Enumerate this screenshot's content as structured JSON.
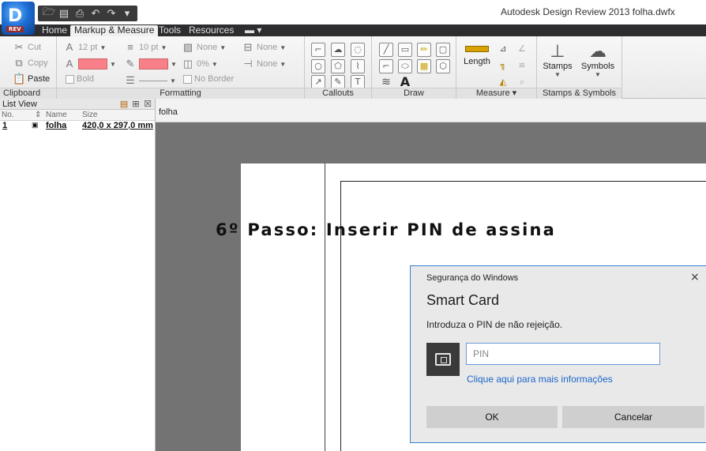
{
  "app": {
    "window_title": "Autodesk Design Review 2013   folha.dwfx",
    "logo_letter": "D",
    "logo_badge": "REV"
  },
  "tabs": [
    {
      "label": "Home"
    },
    {
      "label": "Markup & Measure"
    },
    {
      "label": "Tools"
    },
    {
      "label": "Resources"
    },
    {
      "label": "▬ ▾"
    }
  ],
  "ribbon": {
    "clipboard": {
      "cut": "Cut",
      "copy": "Copy",
      "paste": "Paste",
      "label": "Clipboard"
    },
    "formatting": {
      "font_size": "12 pt",
      "line_weight": "10 pt",
      "fill_none": "None",
      "line_end_none": "None",
      "line_start_none": "None",
      "transparency": "0%",
      "bold": "Bold",
      "no_border": "No Border",
      "label": "Formatting"
    },
    "callouts": {
      "label": "Callouts"
    },
    "draw": {
      "label": "Draw",
      "text_tool": "A"
    },
    "measure": {
      "length": "Length",
      "label": "Measure ▾"
    },
    "stamps": {
      "stamps": "Stamps",
      "symbols": "Symbols",
      "label": "Stamps & Symbols"
    }
  },
  "list_view": {
    "title": "List View",
    "columns": {
      "no": "No.",
      "name": "Name",
      "size": "Size"
    },
    "rows": [
      {
        "no": "1",
        "name": "folha",
        "size": "420,0 x 297,0 mm"
      }
    ]
  },
  "document": {
    "tab": "folha",
    "step_title": "6º Passo: Inserir PIN de assina"
  },
  "dialog": {
    "caption": "Segurança do Windows",
    "close": "×",
    "heading": "Smart Card",
    "message": "Introduza o PIN de não rejeição.",
    "pin_placeholder": "PIN",
    "more_info_link": "Clique aqui para mais informações",
    "ok": "OK",
    "cancel": "Cancelar"
  },
  "colors": {
    "ribbon_tab_bar": "#2d2d30",
    "fill_swatch": "#f98088",
    "canvas": "#737373",
    "dialog_border": "#3a7fd0",
    "link": "#1b66c9"
  }
}
